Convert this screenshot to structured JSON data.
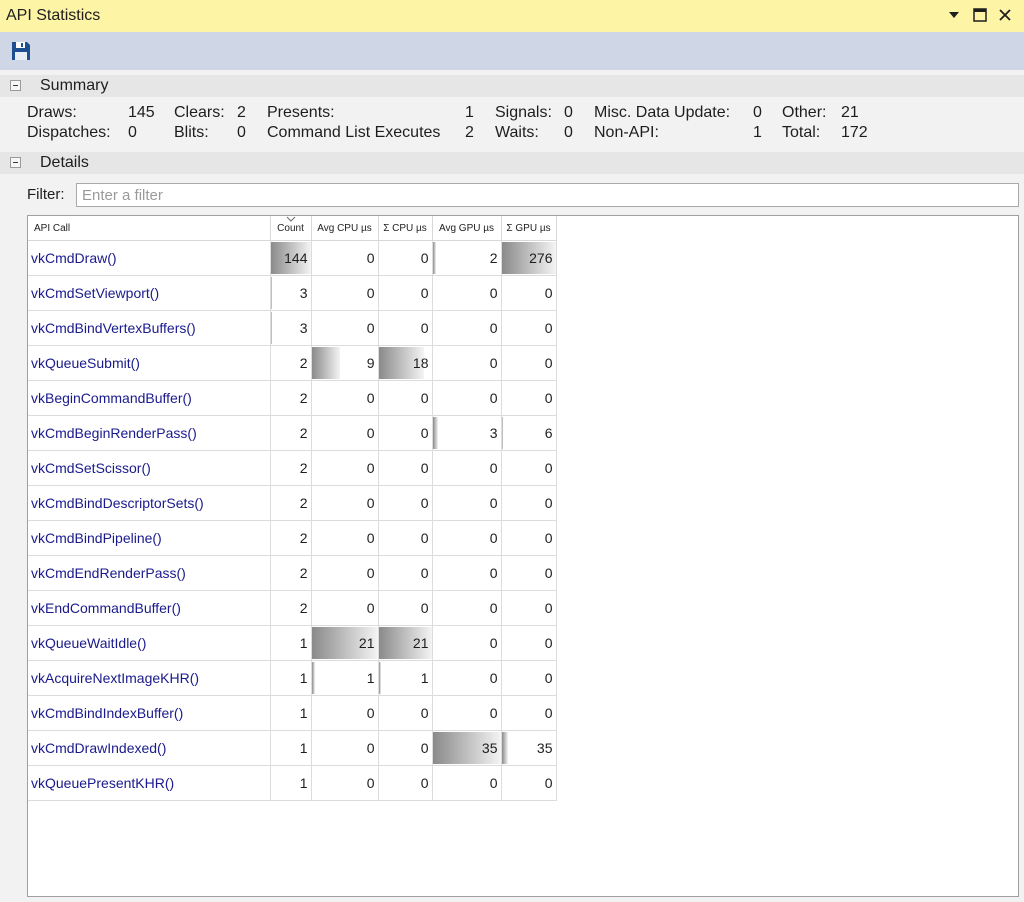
{
  "window": {
    "title": "API Statistics"
  },
  "summary": {
    "header": "Summary",
    "items": [
      {
        "label": "Draws:",
        "value": "145"
      },
      {
        "label": "Dispatches:",
        "value": "0"
      },
      {
        "label": "Clears:",
        "value": "2"
      },
      {
        "label": "Blits:",
        "value": "0"
      },
      {
        "label": "Presents:",
        "value": "1"
      },
      {
        "label": "Command List Executes",
        "value": "2"
      },
      {
        "label": "Signals:",
        "value": "0"
      },
      {
        "label": "Waits:",
        "value": "0"
      },
      {
        "label": "Misc. Data Update:",
        "value": "0"
      },
      {
        "label": "Non-API:",
        "value": "1"
      },
      {
        "label": "Other:",
        "value": "21"
      },
      {
        "label": "Total:",
        "value": "172"
      }
    ]
  },
  "details": {
    "header": "Details",
    "filter_label": "Filter:",
    "filter_placeholder": "Enter a filter",
    "columns": [
      "API Call",
      "Count",
      "Avg CPU µs",
      "Σ CPU µs",
      "Avg GPU µs",
      "Σ GPU µs"
    ],
    "sorted_column": "Count",
    "rows": [
      {
        "name": "vkCmdDraw()",
        "count": 144,
        "avg_cpu": 0,
        "sum_cpu": 0,
        "avg_gpu": 2,
        "sum_gpu": 276
      },
      {
        "name": "vkCmdSetViewport()",
        "count": 3,
        "avg_cpu": 0,
        "sum_cpu": 0,
        "avg_gpu": 0,
        "sum_gpu": 0
      },
      {
        "name": "vkCmdBindVertexBuffers()",
        "count": 3,
        "avg_cpu": 0,
        "sum_cpu": 0,
        "avg_gpu": 0,
        "sum_gpu": 0
      },
      {
        "name": "vkQueueSubmit()",
        "count": 2,
        "avg_cpu": 9,
        "sum_cpu": 18,
        "avg_gpu": 0,
        "sum_gpu": 0
      },
      {
        "name": "vkBeginCommandBuffer()",
        "count": 2,
        "avg_cpu": 0,
        "sum_cpu": 0,
        "avg_gpu": 0,
        "sum_gpu": 0
      },
      {
        "name": "vkCmdBeginRenderPass()",
        "count": 2,
        "avg_cpu": 0,
        "sum_cpu": 0,
        "avg_gpu": 3,
        "sum_gpu": 6
      },
      {
        "name": "vkCmdSetScissor()",
        "count": 2,
        "avg_cpu": 0,
        "sum_cpu": 0,
        "avg_gpu": 0,
        "sum_gpu": 0
      },
      {
        "name": "vkCmdBindDescriptorSets()",
        "count": 2,
        "avg_cpu": 0,
        "sum_cpu": 0,
        "avg_gpu": 0,
        "sum_gpu": 0
      },
      {
        "name": "vkCmdBindPipeline()",
        "count": 2,
        "avg_cpu": 0,
        "sum_cpu": 0,
        "avg_gpu": 0,
        "sum_gpu": 0
      },
      {
        "name": "vkCmdEndRenderPass()",
        "count": 2,
        "avg_cpu": 0,
        "sum_cpu": 0,
        "avg_gpu": 0,
        "sum_gpu": 0
      },
      {
        "name": "vkEndCommandBuffer()",
        "count": 2,
        "avg_cpu": 0,
        "sum_cpu": 0,
        "avg_gpu": 0,
        "sum_gpu": 0
      },
      {
        "name": "vkQueueWaitIdle()",
        "count": 1,
        "avg_cpu": 21,
        "sum_cpu": 21,
        "avg_gpu": 0,
        "sum_gpu": 0
      },
      {
        "name": "vkAcquireNextImageKHR()",
        "count": 1,
        "avg_cpu": 1,
        "sum_cpu": 1,
        "avg_gpu": 0,
        "sum_gpu": 0
      },
      {
        "name": "vkCmdBindIndexBuffer()",
        "count": 1,
        "avg_cpu": 0,
        "sum_cpu": 0,
        "avg_gpu": 0,
        "sum_gpu": 0
      },
      {
        "name": "vkCmdDrawIndexed()",
        "count": 1,
        "avg_cpu": 0,
        "sum_cpu": 0,
        "avg_gpu": 35,
        "sum_gpu": 35
      },
      {
        "name": "vkQueuePresentKHR()",
        "count": 1,
        "avg_cpu": 0,
        "sum_cpu": 0,
        "avg_gpu": 0,
        "sum_gpu": 0
      }
    ]
  },
  "icons": {
    "toolbar": "save-icon",
    "window_controls": [
      "dropdown-arrow-icon",
      "maximize-icon",
      "close-icon"
    ],
    "section_toggles": "collapse-icon"
  },
  "colors": {
    "titlebar": "#fdf4a6",
    "toolbar": "#cfd6e5",
    "api_link": "#1a1a8c",
    "bar_dark": "#8a8a8a"
  }
}
